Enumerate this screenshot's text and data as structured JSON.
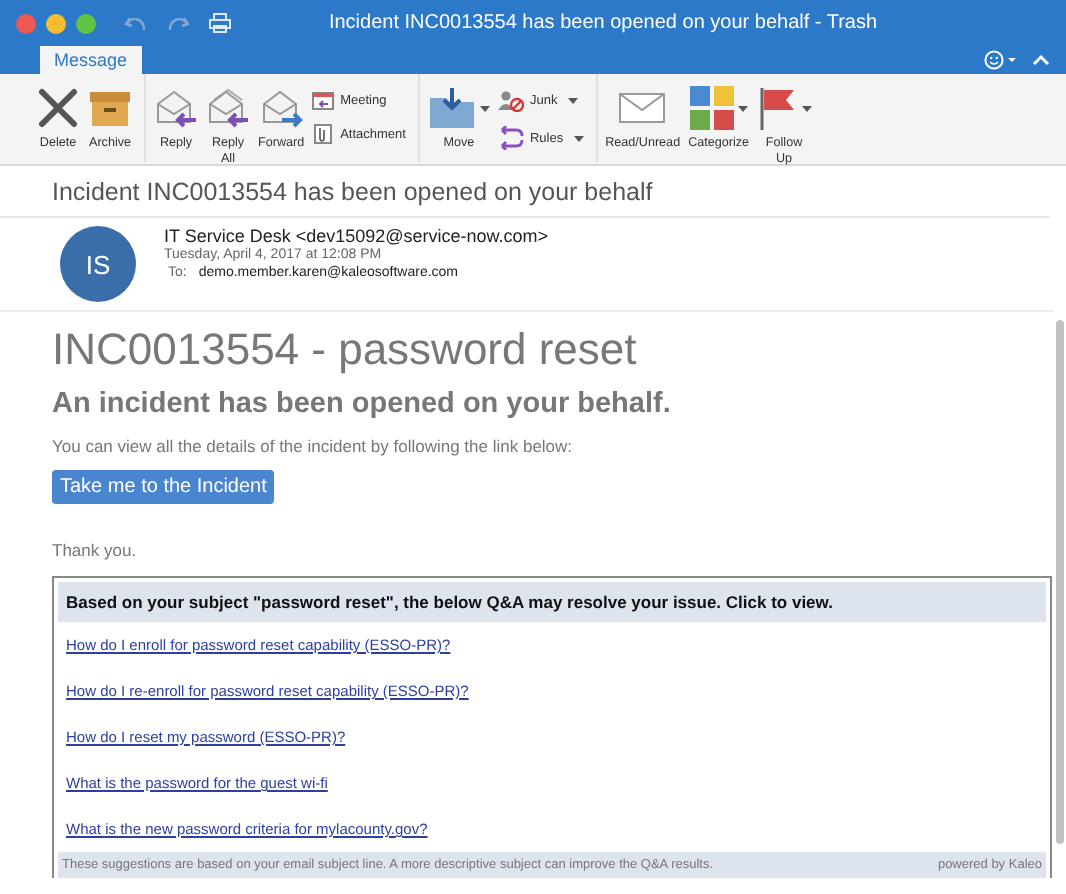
{
  "window": {
    "title": "Incident INC0013554 has been opened on your behalf - Trash"
  },
  "ribbon_tabs": [
    {
      "label": "Message",
      "selected": true
    }
  ],
  "ribbon_groups": [
    [
      {
        "kind": "large",
        "label": "Delete"
      },
      {
        "kind": "large",
        "label": "Archive"
      }
    ],
    [
      {
        "kind": "large",
        "label": "Reply"
      },
      {
        "kind": "large",
        "label": "Reply All"
      },
      {
        "kind": "large",
        "label": "Forward"
      },
      {
        "kind": "stack",
        "items": [
          {
            "label": "Meeting"
          },
          {
            "label": "Attachment"
          }
        ]
      }
    ],
    [
      {
        "kind": "large",
        "label": "Move",
        "menu": true
      },
      {
        "kind": "stack",
        "items": [
          {
            "label": "Junk",
            "menu": true
          },
          {
            "label": "Rules",
            "menu": true
          }
        ]
      }
    ],
    [
      {
        "kind": "large",
        "label": "Read/Unread"
      },
      {
        "kind": "large",
        "label": "Categorize",
        "menu": true
      },
      {
        "kind": "large",
        "label": "Follow Up",
        "menu": true
      }
    ]
  ],
  "message": {
    "subject": "Incident INC0013554 has been opened on your behalf",
    "sender": {
      "initials": "IS",
      "from": "IT Service Desk <dev15092@service-now.com>",
      "date": "Tuesday, April 4, 2017 at 12:08 PM",
      "to_label": "To:",
      "to": "demo.member.karen@kaleosoftware.com"
    }
  },
  "body": {
    "heading": "INC0013554 - password reset",
    "subheading": "An incident has been opened on your behalf.",
    "text": "You can view all the details of the incident by following the link below:",
    "button": "Take me to the Incident",
    "thanks": "Thank you."
  },
  "suggestions": {
    "header": "Based on your subject \"password reset\", the below Q&A may resolve your issue. Click to view.",
    "links": [
      "How do I enroll for password reset capability (ESSO-PR)?",
      "How do I re-enroll for password reset capability (ESSO-PR)?",
      "How do I reset my password (ESSO-PR)?",
      "What is the password for the guest wi-fi",
      "What is the new password criteria for mylacounty.gov?"
    ],
    "note": "These suggestions are based on your email subject line. A more descriptive subject can improve the Q&A results.",
    "powered_by": "powered by Kaleo"
  }
}
